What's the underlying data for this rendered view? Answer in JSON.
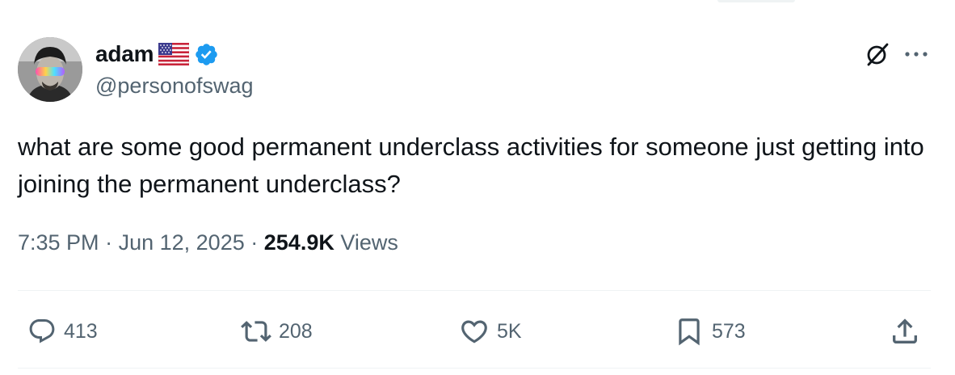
{
  "author": {
    "display_name": "adam",
    "handle": "@personofswag",
    "flag_icon": "us-flag-icon",
    "verified_icon": "verified-badge-icon",
    "verified_color": "#1d9bf0"
  },
  "tweet": {
    "text": "what are some good permanent underclass activities for someone just getting into joining the permanent underclass?",
    "time": "7:35 PM",
    "separator": "·",
    "date": "Jun 12, 2025",
    "views_count": "254.9K",
    "views_label": "Views"
  },
  "header_actions": {
    "grok_icon": "grok-icon",
    "more_icon": "more-icon"
  },
  "actions": {
    "replies": "413",
    "reposts": "208",
    "likes": "5K",
    "bookmarks": "573",
    "share_icon": "share-icon"
  },
  "colors": {
    "text_primary": "#0f1419",
    "text_secondary": "#536471",
    "divider": "#eff3f4"
  }
}
